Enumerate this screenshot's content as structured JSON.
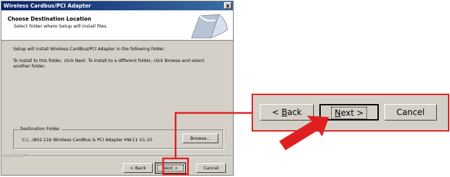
{
  "dialog": {
    "title": "Wireless Cardbus/PCI Adapter",
    "close_label": "x",
    "header_title": "Choose Destination Location",
    "header_subtitle": "Select folder where Setup will install files.",
    "line1": "Setup will install Wireless CardBus/PCI Adapter in the following folder.",
    "line2": "To install to this folder, click Next. To install to a different folder, click Browse and select",
    "line3": "another folder.",
    "dest_label": "Destination Folder",
    "dest_path": "C:\\...\\802.11b Wireless CardBus & PCI Adapter HW.11 V1.10",
    "browse_label": "Browse...",
    "installshield": "InstallShield",
    "back_label": "< Back",
    "next_label": "Next >",
    "cancel_label": "Cancel"
  },
  "zoom": {
    "back_prefix": "< ",
    "back_key": "B",
    "back_rest": "ack",
    "next_key": "N",
    "next_rest": "ext >",
    "cancel_label": "Cancel"
  },
  "colors": {
    "highlight": "#e02020",
    "titlebar": "#0a246a"
  }
}
